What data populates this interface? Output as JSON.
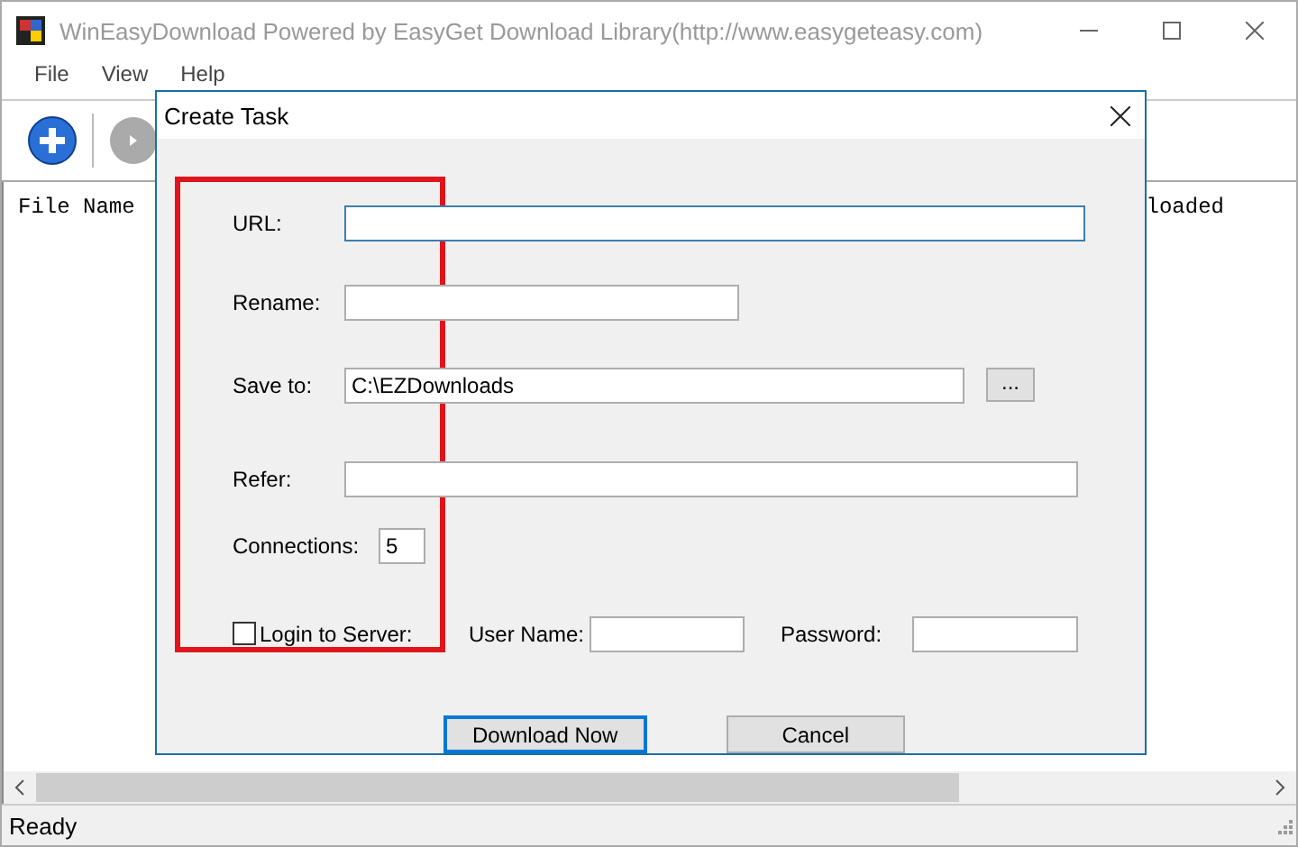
{
  "window": {
    "title": "WinEasyDownload Powered by EasyGet Download Library(http://www.easygeteasy.com)"
  },
  "menu": [
    "File",
    "View",
    "Help"
  ],
  "list": {
    "columns": [
      "File Name",
      "loaded"
    ]
  },
  "dialog": {
    "title": "Create Task",
    "url": {
      "label": "URL:"
    },
    "rename": {
      "label": "Rename:"
    },
    "save_to": {
      "label": "Save to:",
      "value": "C:\\EZDownloads",
      "browse": "..."
    },
    "refer": {
      "label": "Refer:"
    },
    "connections": {
      "label": "Connections:",
      "value": "5"
    },
    "login": {
      "label": "Login to Server:",
      "checked": false
    },
    "user_name": {
      "label": "User Name:"
    },
    "password": {
      "label": "Password:"
    },
    "buttons": [
      {
        "label": "Download Now",
        "default": true
      },
      {
        "label": "Cancel",
        "default": false
      }
    ]
  },
  "status_bar": "Ready"
}
